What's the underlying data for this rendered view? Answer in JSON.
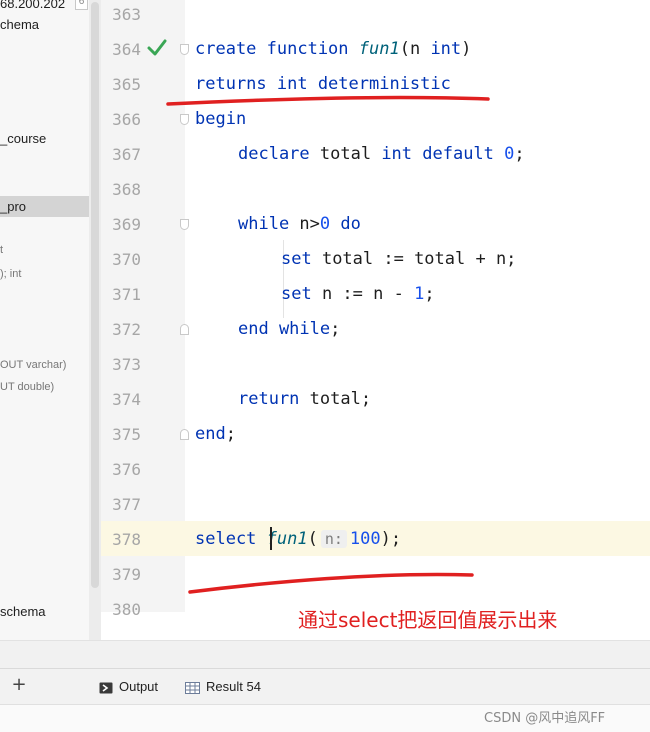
{
  "tree": {
    "items": [
      {
        "label": "68.200.202",
        "badge": "6",
        "small": false,
        "selected": false
      },
      {
        "label": "chema",
        "small": false,
        "selected": false
      },
      {
        "label": "_course",
        "small": false,
        "selected": false
      },
      {
        "label": "_pro",
        "small": false,
        "selected": true
      },
      {
        "label": "t",
        "small": true,
        "selected": false
      },
      {
        "label": "); int",
        "small": true,
        "selected": false
      },
      {
        "label": "OUT varchar)",
        "small": true,
        "selected": false
      },
      {
        "label": "UT double)",
        "small": true,
        "selected": false
      },
      {
        "label": "schema",
        "small": false,
        "selected": false
      }
    ]
  },
  "editor": {
    "line_numbers": [
      "363",
      "364",
      "365",
      "366",
      "367",
      "368",
      "369",
      "370",
      "371",
      "372",
      "373",
      "374",
      "375",
      "376",
      "377",
      "378",
      "379",
      "380"
    ],
    "lines": {
      "l364": {
        "kw1": "create function ",
        "fn": "fun1",
        "rest": "(n ",
        "kw2": "int",
        "end": ")"
      },
      "l365": {
        "kw": "returns int deterministic"
      },
      "l366": {
        "kw": "begin"
      },
      "l367": {
        "kw1": "declare ",
        "t1": "total ",
        "kw2": "int default ",
        "num": "0",
        "end": ";"
      },
      "l369": {
        "kw1": "while ",
        "t1": "n>",
        "num": "0",
        "kw2": " do"
      },
      "l370": {
        "kw": "set ",
        "text": "total := total + n;"
      },
      "l371": {
        "kw": "set ",
        "text": "n := n - ",
        "num": "1",
        "end": ";"
      },
      "l372": {
        "kw": "end while",
        "end": ";"
      },
      "l374": {
        "kw": "return ",
        "text": "total;"
      },
      "l375": {
        "kw": "end",
        "end": ";"
      },
      "l378": {
        "kw": "select ",
        "fn": "fun1",
        "open": "(",
        "hint": "n:",
        "num": "100",
        "end": ");"
      }
    }
  },
  "annotation": {
    "text": "通过select把返回值展示出来",
    "color": "#e02020"
  },
  "bottom": {
    "add_label": "+",
    "tabs": [
      {
        "label": "Output",
        "icon": "output-icon"
      },
      {
        "label": "Result 54",
        "icon": "grid-icon"
      }
    ]
  },
  "watermark": "CSDN @风中追风FF",
  "colors": {
    "keyword": "#0033b3",
    "function": "#00627a",
    "number": "#1750eb",
    "check": "#3aa655",
    "ink": "#e02020"
  }
}
